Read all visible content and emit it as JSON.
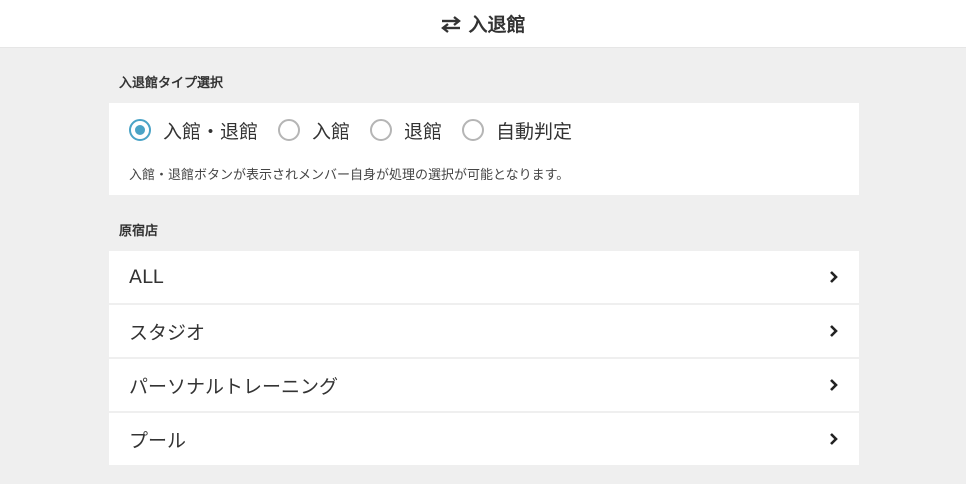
{
  "header": {
    "title": "入退館",
    "icon": "swap-arrows-icon"
  },
  "entry_type": {
    "section_label": "入退館タイプ選択",
    "options": [
      {
        "label": "入館・退館",
        "selected": true
      },
      {
        "label": "入館",
        "selected": false
      },
      {
        "label": "退館",
        "selected": false
      },
      {
        "label": "自動判定",
        "selected": false
      }
    ],
    "description": "入館・退館ボタンが表示されメンバー自身が処理の選択が可能となります。",
    "accent_color": "#4aa3c6"
  },
  "store": {
    "section_label": "原宿店",
    "items": [
      {
        "label": "ALL",
        "icon": "chevron-right-icon"
      },
      {
        "label": "スタジオ",
        "icon": "chevron-right-icon"
      },
      {
        "label": "パーソナルトレーニング",
        "icon": "chevron-right-icon"
      },
      {
        "label": "プール",
        "icon": "chevron-right-icon"
      }
    ]
  }
}
